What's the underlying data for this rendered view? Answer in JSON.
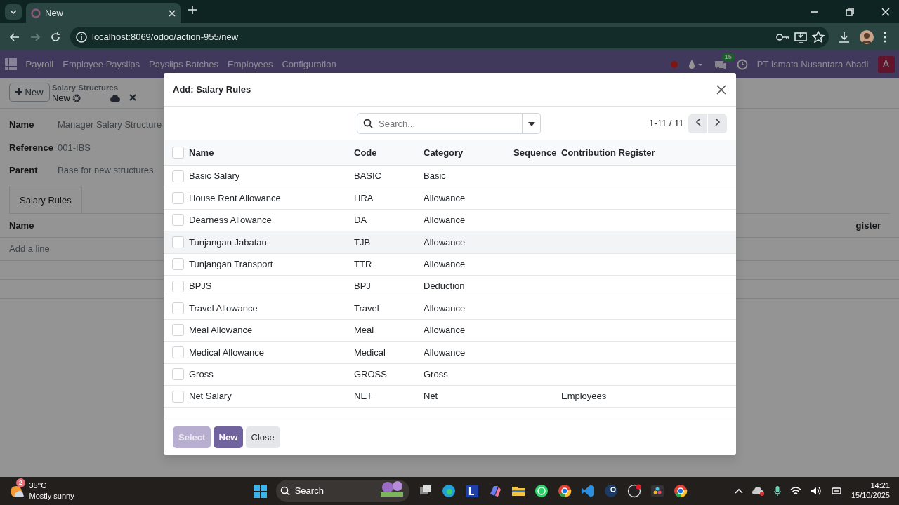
{
  "browser": {
    "tab_title": "New",
    "url": "localhost:8069/odoo/action-955/new"
  },
  "app_nav": {
    "app": "Payroll",
    "menu": [
      "Employee Payslips",
      "Payslips Batches",
      "Employees",
      "Configuration"
    ],
    "messages_count": "15",
    "company": "PT Ismata Nusantara Abadi",
    "avatar_letter": "A"
  },
  "control_panel": {
    "new_button": "New",
    "breadcrumb_parent": "Salary Structures",
    "breadcrumb_current": "New"
  },
  "form": {
    "fields": [
      {
        "label": "Name",
        "value": "Manager Salary Structure"
      },
      {
        "label": "Reference",
        "value": "001-IBS"
      },
      {
        "label": "Parent",
        "value": "Base for new structures"
      }
    ],
    "tabs": [
      {
        "label": "Salary Rules",
        "selected": true
      }
    ],
    "lines": {
      "column_1": "Name",
      "column_2": "gister",
      "add_line": "Add a line"
    }
  },
  "dialog": {
    "title": "Add: Salary Rules",
    "search": {
      "placeholder": "Search..."
    },
    "select_all_checked": false,
    "pager": "1-11 / 11",
    "columns": [
      "Name",
      "Code",
      "Category",
      "Sequence",
      "Contribution Register"
    ],
    "rows": [
      {
        "name": "Basic Salary",
        "code": "BASIC",
        "category": "Basic",
        "checked": false,
        "hovered": false
      },
      {
        "name": "House Rent Allowance",
        "code": "HRA",
        "category": "Allowance",
        "checked": false,
        "hovered": false
      },
      {
        "name": "Dearness Allowance",
        "code": "DA",
        "category": "Allowance",
        "checked": false,
        "hovered": false
      },
      {
        "name": "Tunjangan Jabatan",
        "code": "TJB",
        "category": "Allowance",
        "checked": false,
        "hovered": true
      },
      {
        "name": "Tunjangan Transport",
        "code": "TTR",
        "category": "Allowance",
        "checked": false,
        "hovered": false
      },
      {
        "name": "BPJS",
        "code": "BPJ",
        "category": "Deduction",
        "checked": false,
        "hovered": false
      },
      {
        "name": "Travel Allowance",
        "code": "Travel",
        "category": "Allowance",
        "checked": false,
        "hovered": false
      },
      {
        "name": "Meal Allowance",
        "code": "Meal",
        "category": "Allowance",
        "checked": false,
        "hovered": false
      },
      {
        "name": "Medical Allowance",
        "code": "Medical",
        "category": "Allowance",
        "checked": false,
        "hovered": false
      },
      {
        "name": "Gross",
        "code": "GROSS",
        "category": "Gross",
        "checked": false,
        "hovered": false
      },
      {
        "name": "Net Salary",
        "code": "NET",
        "category": "Net",
        "register": "Employees",
        "checked": false,
        "hovered": false
      }
    ],
    "buttons": [
      {
        "label": "Select",
        "kind": "primary",
        "disabled": true
      },
      {
        "label": "New",
        "kind": "primary",
        "disabled": false
      },
      {
        "label": "Close",
        "kind": "secondary",
        "disabled": false
      }
    ]
  },
  "taskbar": {
    "weather_badge": "2",
    "temperature": "35°C",
    "condition": "Mostly sunny",
    "search": "Search",
    "time": "14:21",
    "date": "15/10/2025"
  }
}
